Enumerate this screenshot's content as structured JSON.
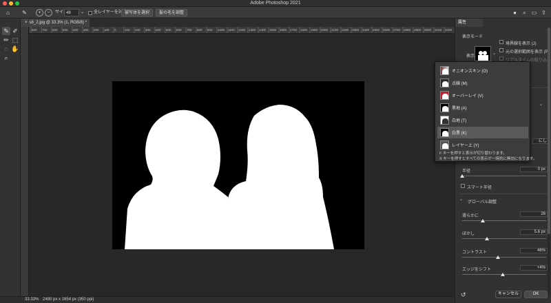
{
  "app": {
    "title": "Adobe Photoshop 2021"
  },
  "options_bar": {
    "size_label": "サイズ：",
    "size_value": "48",
    "sample_all_layers": "全レイヤーを対象",
    "select_subject": "被写体を選択",
    "refine_hair": "髪の毛を調整"
  },
  "document": {
    "tab_label": "s8_2.jpg @ 33.3% (1, RGB/8) *",
    "ruler_ticks": [
      "800",
      "700",
      "600",
      "500",
      "400",
      "300",
      "200",
      "100",
      "0",
      "100",
      "200",
      "300",
      "400",
      "500",
      "600",
      "700",
      "800",
      "900",
      "1000",
      "1100",
      "1200",
      "1300",
      "1400",
      "1500",
      "1600",
      "1700",
      "1800",
      "1900",
      "2000",
      "2100",
      "2200",
      "2300",
      "2400",
      "2500",
      "2600",
      "2700",
      "2800",
      "2900",
      "3000",
      "3100",
      "3200"
    ]
  },
  "status": {
    "zoom": "33.33%",
    "dimensions": "2480 px x 1654 px (350 ppi)"
  },
  "properties": {
    "tab": "属性",
    "view_mode_label": "表示モード",
    "view_label": "表示",
    "show_edges": "境界線を表示 (J)",
    "show_original": "元の選択範囲を表示 (P)",
    "realtime": "リアルタイムの絞り込み",
    "radius_label": "半径",
    "radius_value": "0 px",
    "smart_radius": "スマート半径",
    "global_label": "グローバル調整",
    "smooth_label": "滑らかに",
    "smooth_value": "26",
    "feather_label": "ぼかし",
    "feather_value": "5.6 px",
    "contrast_label": "コントラスト",
    "contrast_value": "46%",
    "shift_label": "エッジをシフト",
    "shift_value": "+4%",
    "cancel": "キャンセル",
    "ok": "OK",
    "hidden_right": "にし"
  },
  "view_menu": {
    "items": [
      {
        "label": "オニオンスキン (O)"
      },
      {
        "label": "点線 (M)"
      },
      {
        "label": "オーバーレイ (V)"
      },
      {
        "label": "黒地 (A)"
      },
      {
        "label": "白地 (T)"
      },
      {
        "label": "白黒 (K)",
        "selected": true
      },
      {
        "label": "レイヤー上 (Y)"
      }
    ],
    "note1": "F キーを押すと表示が切り替わります。",
    "note2": "X キーを押すとすべての表示が一時的に無効になります。"
  },
  "colors": {
    "accent": "#1473e6",
    "mask_white": "#ffffff",
    "background": "#000000"
  }
}
